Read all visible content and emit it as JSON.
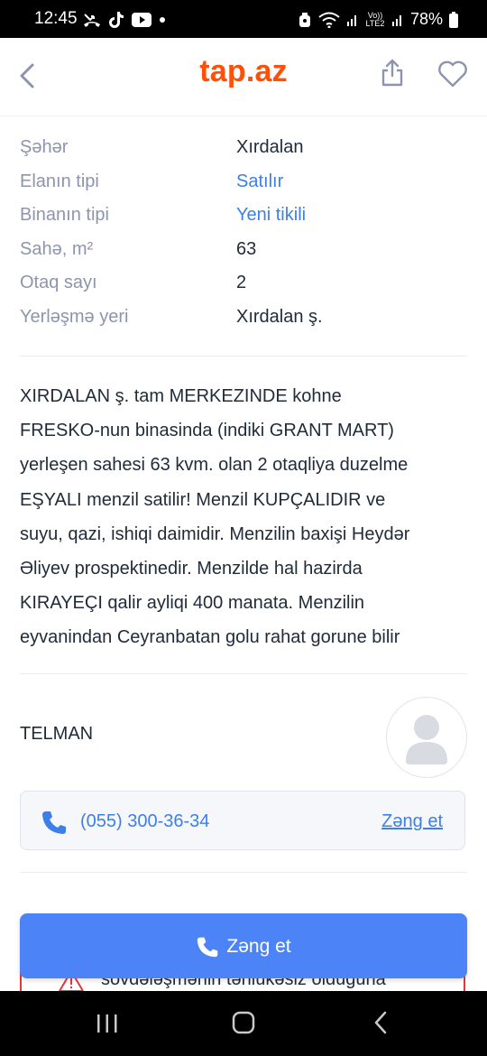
{
  "status_bar": {
    "time": "12:45",
    "battery": "78%",
    "network_label": "Vo)) LTE2"
  },
  "header": {
    "logo": "tap.az"
  },
  "properties": [
    {
      "label": "Şəhər",
      "value": "Xırdalan",
      "link": false
    },
    {
      "label": "Elanın tipi",
      "value": "Satılır",
      "link": true
    },
    {
      "label": "Binanın tipi",
      "value": "Yeni tikili",
      "link": true
    },
    {
      "label": "Sahə, m²",
      "value": "63",
      "link": false
    },
    {
      "label": "Otaq sayı",
      "value": "2",
      "link": false
    },
    {
      "label": "Yerləşmə yeri",
      "value": "Xırdalan ş.",
      "link": false
    }
  ],
  "description": [
    "XIRDALAN ş. tam MERKEZINDE kohne",
    "FRESKO-nun binasinda (indiki GRANT MART)",
    "yerleşen sahesi 63 kvm. olan 2 otaqliya duzelme",
    "EŞYALI menzil satilir! Menzil KUPÇALIDIR ve",
    "suyu, qazi, ishiqi daimidir. Menzilin baxişi Heydər",
    "Əliyev prospektinedir. Menzilde hal hazirda",
    "KIRAYEÇI qalir ayliqi 400 manata. Menzilin",
    "eyvanindan Ceyranbatan golu rahat gorune bilir"
  ],
  "seller": {
    "name": "TELMAN"
  },
  "contact": {
    "phone": "(055) 300-36-34",
    "call_link": "Zəng et"
  },
  "warning": {
    "text": "sövdələşmənin təhlükəsiz olduğuna"
  },
  "call_button": {
    "label": "Zəng et"
  },
  "colors": {
    "brand": "#ff4f08",
    "link": "#3d7fea",
    "call_button": "#4c84f7",
    "warning_border": "#e0383e"
  }
}
